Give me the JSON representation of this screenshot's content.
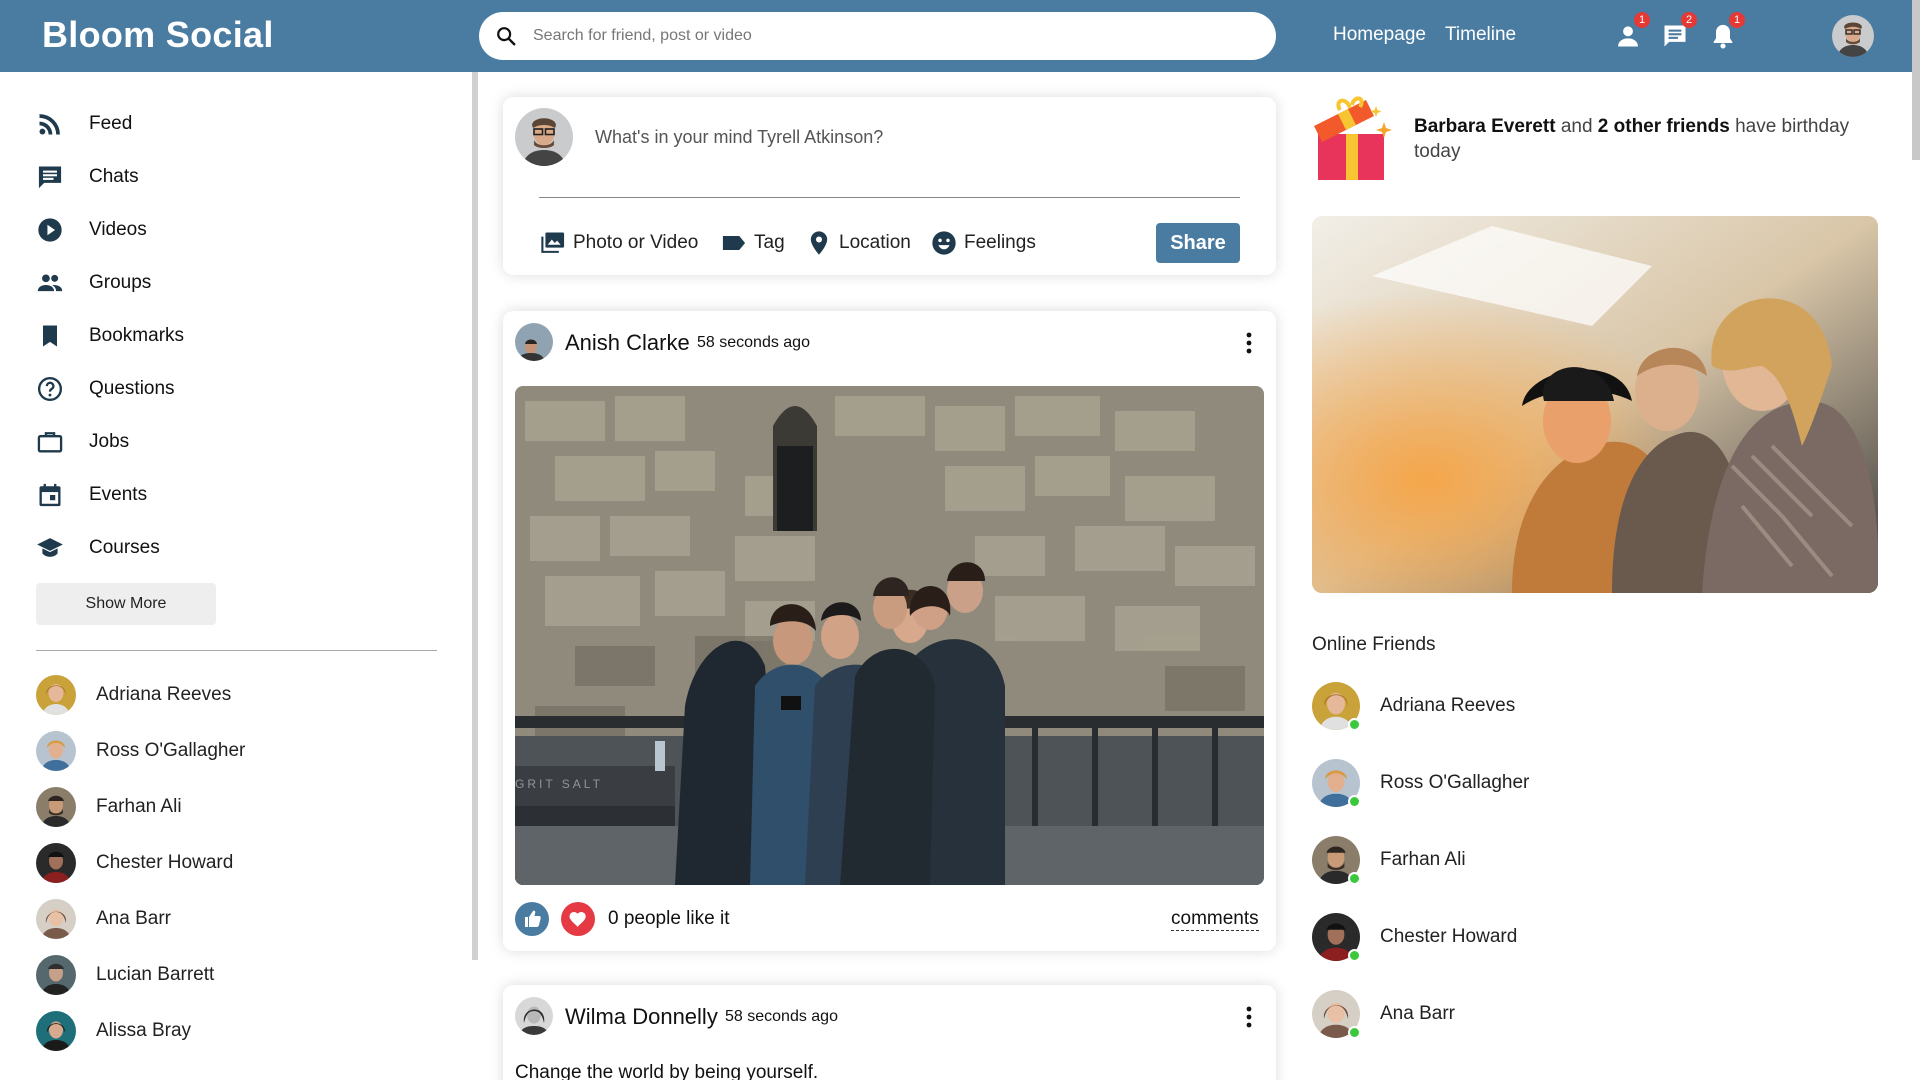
{
  "header": {
    "brand": "Bloom Social",
    "search_placeholder": "Search for friend, post or video",
    "links": [
      "Homepage",
      "Timeline"
    ],
    "badges": {
      "friend_requests": "1",
      "messages": "2",
      "notifications": "1"
    }
  },
  "sidebar": {
    "nav": [
      {
        "label": "Feed",
        "icon": "rss-feed-icon"
      },
      {
        "label": "Chats",
        "icon": "chat-icon"
      },
      {
        "label": "Videos",
        "icon": "play-circle-icon"
      },
      {
        "label": "Groups",
        "icon": "group-icon"
      },
      {
        "label": "Bookmarks",
        "icon": "bookmark-icon"
      },
      {
        "label": "Questions",
        "icon": "help-circle-icon"
      },
      {
        "label": "Jobs",
        "icon": "briefcase-icon"
      },
      {
        "label": "Events",
        "icon": "calendar-icon"
      },
      {
        "label": "Courses",
        "icon": "graduation-cap-icon"
      }
    ],
    "show_more": "Show More",
    "friends": [
      "Adriana Reeves",
      "Ross O'Gallagher",
      "Farhan Ali",
      "Chester Howard",
      "Ana Barr",
      "Lucian Barrett",
      "Alissa Bray"
    ]
  },
  "share": {
    "placeholder": "What's in your mind Tyrell Atkinson?",
    "options": [
      "Photo or Video",
      "Tag",
      "Location",
      "Feelings"
    ],
    "button": "Share"
  },
  "posts": [
    {
      "author": "Anish Clarke",
      "time": "58 seconds ago",
      "likes_text": "0 people like it",
      "comments_label": "comments"
    },
    {
      "author": "Wilma Donnelly",
      "time": "58 seconds ago",
      "text": "Change the world by being yourself."
    }
  ],
  "birthday": {
    "name": "Barbara Everett",
    "connector": "and",
    "others": "2 other friends",
    "suffix": "have birthday today"
  },
  "online": {
    "title": "Online Friends",
    "friends": [
      "Adriana Reeves",
      "Ross O'Gallagher",
      "Farhan Ali",
      "Chester Howard",
      "Ana Barr"
    ]
  },
  "colors": {
    "primary": "#4a7ca2",
    "badge": "#e53935",
    "online": "#3cc83c",
    "heart": "#e53944"
  }
}
